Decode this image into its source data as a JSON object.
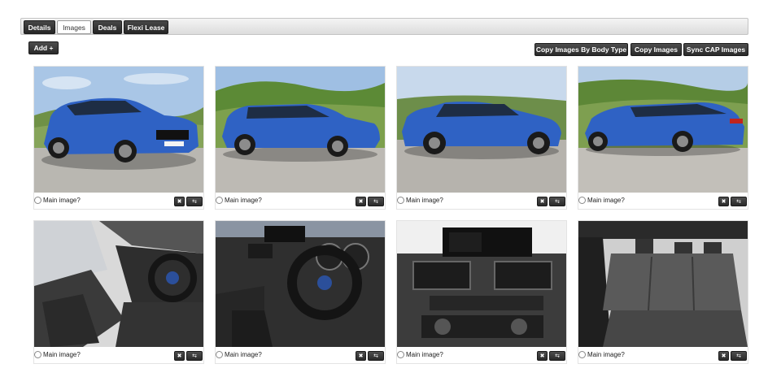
{
  "tabs": [
    {
      "label": "Details",
      "active": false
    },
    {
      "label": "Images",
      "active": true
    },
    {
      "label": "Deals",
      "active": false
    },
    {
      "label": "Flexi Lease",
      "active": false
    }
  ],
  "toolbar": {
    "add_label": "Add +",
    "copy_by_body_label": "Copy Images By Body Type",
    "copy_label": "Copy Images",
    "sync_label": "Sync CAP Images"
  },
  "images": [
    {
      "kind": "car-front-three-quarter",
      "main_label": "Main image?"
    },
    {
      "kind": "car-side-right",
      "main_label": "Main image?"
    },
    {
      "kind": "car-side-left",
      "main_label": "Main image?"
    },
    {
      "kind": "car-rear-three-quarter",
      "main_label": "Main image?"
    },
    {
      "kind": "interior-front-seats",
      "main_label": "Main image?"
    },
    {
      "kind": "interior-steering-wheel",
      "main_label": "Main image?"
    },
    {
      "kind": "interior-center-console",
      "main_label": "Main image?"
    },
    {
      "kind": "interior-rear-seats",
      "main_label": "Main image?"
    }
  ],
  "icons": {
    "delete": "close-icon",
    "link": "link-icon"
  },
  "colors": {
    "button_dark": "#2a2a2a",
    "car_blue": "#2f62c4",
    "sky": "#a8c6e8",
    "hills": "#5f8a3a",
    "leather": "#3a3a3a"
  }
}
